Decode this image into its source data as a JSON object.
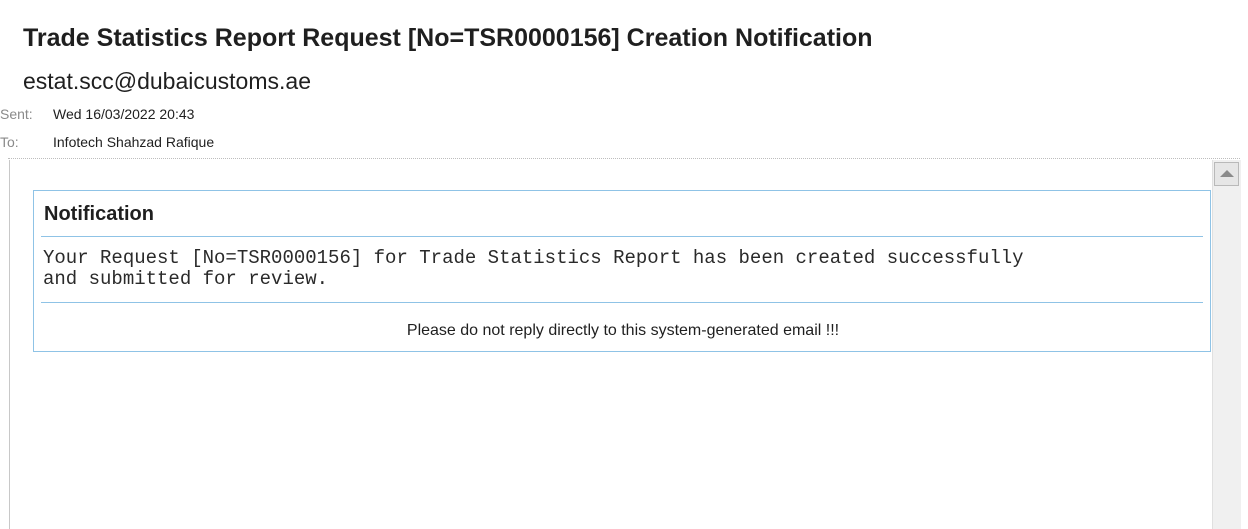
{
  "email": {
    "subject": "Trade Statistics Report Request [No=TSR0000156] Creation Notification",
    "sender": "estat.scc@dubaicustoms.ae",
    "sent_label": "Sent:",
    "sent_value": "Wed 16/03/2022 20:43",
    "to_label": "To:",
    "to_value": "Infotech Shahzad Rafique"
  },
  "body": {
    "heading": "Notification",
    "message": "Your Request [No=TSR0000156] for Trade Statistics Report has been created successfully\nand submitted for review.",
    "footer": "Please do not reply directly to this system-generated email !!!"
  },
  "scrollbar": {
    "up_icon": "scroll-up-arrow-icon"
  },
  "colors": {
    "box_border": "#8fc3e6",
    "label_gray": "#8a8a8a",
    "text": "#1f1f1f"
  }
}
